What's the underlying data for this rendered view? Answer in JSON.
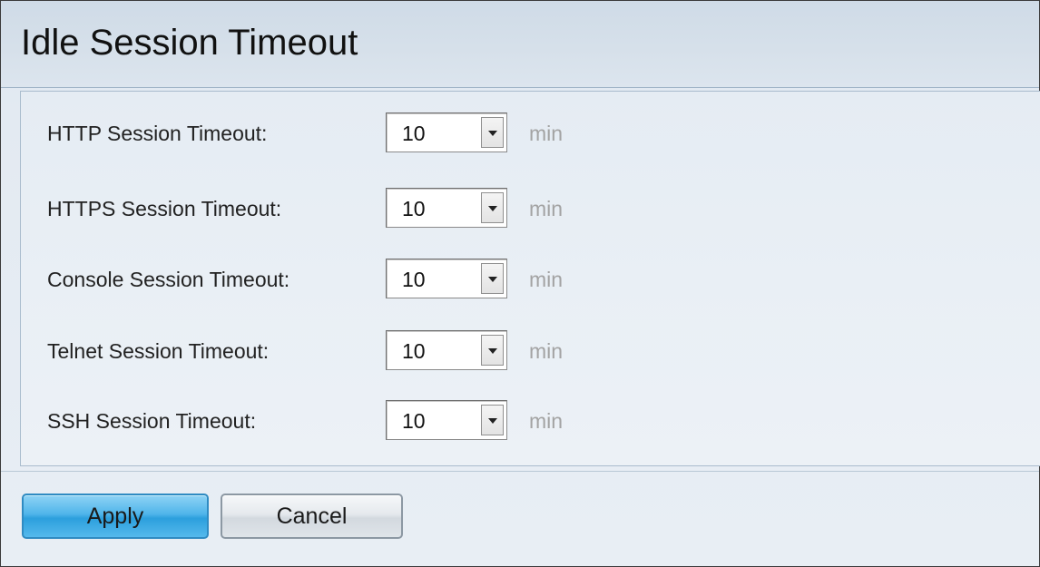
{
  "page": {
    "title": "Idle Session Timeout"
  },
  "settings": [
    {
      "label": "HTTP Session Timeout:",
      "value": "10",
      "unit": "min"
    },
    {
      "label": "HTTPS Session Timeout:",
      "value": "10",
      "unit": "min"
    },
    {
      "label": "Console Session Timeout:",
      "value": "10",
      "unit": "min"
    },
    {
      "label": "Telnet Session Timeout:",
      "value": "10",
      "unit": "min"
    },
    {
      "label": "SSH Session Timeout:",
      "value": "10",
      "unit": "min"
    }
  ],
  "actions": {
    "apply_label": "Apply",
    "cancel_label": "Cancel"
  },
  "icons": {
    "dropdown": "chevron-down-icon"
  },
  "colors": {
    "apply_accent": "#2c9fdd",
    "unit_text": "#a3a3a3"
  }
}
